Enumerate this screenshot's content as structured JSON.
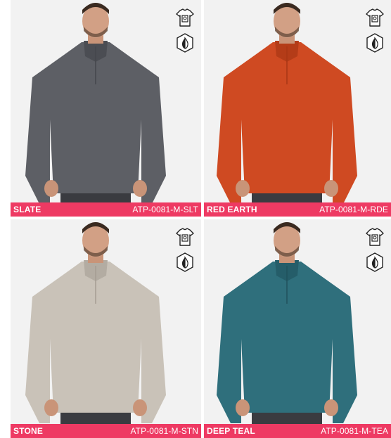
{
  "products": [
    {
      "color_name": "SLATE",
      "sku": "ATP-0081-M-SLT",
      "shirt_color": "#5d5f65",
      "shirt_shade": "#4b4d53"
    },
    {
      "color_name": "RED EARTH",
      "sku": "ATP-0081-M-RDE",
      "shirt_color": "#cf4a22",
      "shirt_shade": "#b43c18"
    },
    {
      "color_name": "STONE",
      "sku": "ATP-0081-M-STN",
      "shirt_color": "#c9c2b8",
      "shirt_shade": "#b3aca2"
    },
    {
      "color_name": "DEEP TEAL",
      "sku": "ATP-0081-M-TEA",
      "shirt_color": "#2f6f7c",
      "shirt_shade": "#255d69"
    }
  ],
  "badges": {
    "first": "shirt-print-icon",
    "second": "moisture-shield-icon"
  },
  "colors": {
    "label_bar": "#ee3a63",
    "card_bg": "#f2f2f2"
  }
}
